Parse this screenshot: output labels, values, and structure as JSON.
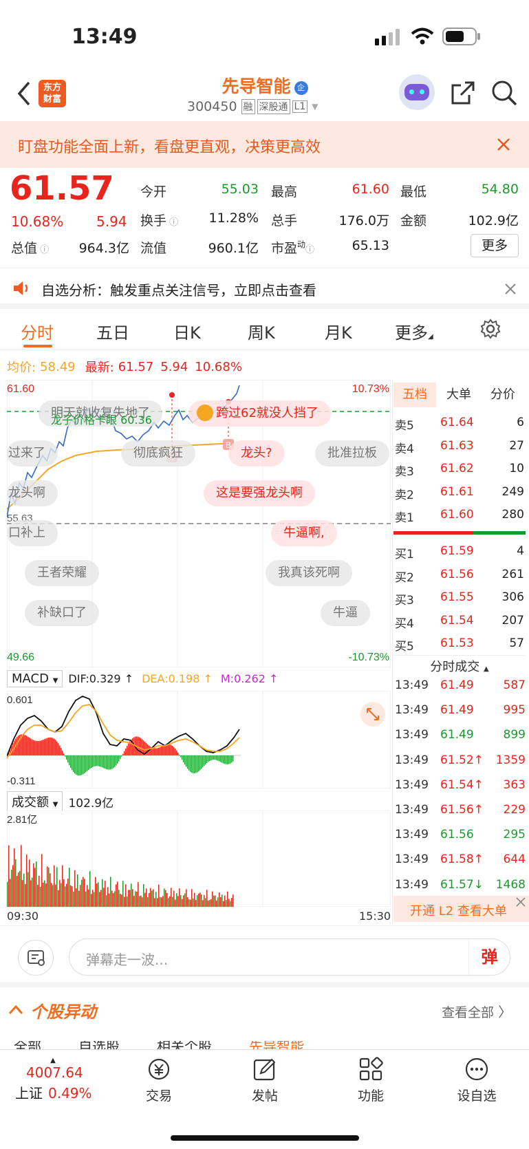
{
  "status": {
    "time": "13:49"
  },
  "header": {
    "logo_line1": "东方",
    "logo_line2": "财富",
    "stock_name": "先导智能",
    "badge": "企",
    "code": "300450",
    "tags": [
      "融",
      "深股通",
      "L1"
    ]
  },
  "banner": {
    "text": "盯盘功能全面上新，看盘更直观，决策更高效"
  },
  "quote": {
    "price": "61.57",
    "pct": "10.68%",
    "change": "5.94",
    "labels": {
      "open": "今开",
      "high": "最高",
      "low": "最低",
      "turnover": "换手",
      "volume": "总手",
      "amount": "金额",
      "mktcap": "总值",
      "float": "流值",
      "pe": "市盈",
      "pe_sup": "动"
    },
    "open": "55.03",
    "high": "61.60",
    "low": "54.80",
    "turnover": "11.28%",
    "volume": "176.0万",
    "amount": "102.9亿",
    "mktcap": "964.3亿",
    "float": "960.1亿",
    "pe": "65.13",
    "more": "更多"
  },
  "notice": {
    "text": "自选分析：触发重点关注信号，立即点击查看"
  },
  "tabs": [
    "分时",
    "五日",
    "日K",
    "周K",
    "月K",
    "更多"
  ],
  "chart_info": {
    "avg_label": "均价:",
    "avg_value": "58.49",
    "last_label": "最新:",
    "last_value": "61.57",
    "change": "5.94",
    "pct": "10.68%"
  },
  "axis": {
    "top_price": "61.60",
    "bottom_price": "49.66",
    "top_pct": "10.73%",
    "bottom_pct": "-10.73%",
    "mid_price": "55.63",
    "start_time": "09:30",
    "end_time": "15:30"
  },
  "marker": {
    "b1": "B",
    "b2": "B"
  },
  "macd": {
    "name": "MACD",
    "dif": "DIF:0.329 ↑",
    "dea": "DEA:0.198 ↑",
    "m": "M:0.262 ↑",
    "top": "0.601",
    "bottom": "-0.311"
  },
  "volume_panel": {
    "name": "成交额",
    "total": "102.9亿",
    "top": "2.81亿"
  },
  "danmu": [
    "明天就收复失地了",
    "龙子价格卡眼 60.36",
    "跨过62就没人挡了",
    "过来了",
    "彻底疯狂",
    "龙头?",
    "批准拉板",
    "龙头啊",
    "这是要强龙头啊",
    "口补上",
    "牛逼啊,",
    "王者荣耀",
    "我真该死啊",
    "补缺口了",
    "牛逼"
  ],
  "orderbook": {
    "tabs": [
      "五档",
      "大单",
      "分价"
    ],
    "asks": [
      {
        "label": "卖5",
        "price": "61.64",
        "qty": "6"
      },
      {
        "label": "卖4",
        "price": "61.63",
        "qty": "27"
      },
      {
        "label": "卖3",
        "price": "61.62",
        "qty": "10"
      },
      {
        "label": "卖2",
        "price": "61.61",
        "qty": "249"
      },
      {
        "label": "卖1",
        "price": "61.60",
        "qty": "280"
      }
    ],
    "bids": [
      {
        "label": "买1",
        "price": "61.59",
        "qty": "4"
      },
      {
        "label": "买2",
        "price": "61.56",
        "qty": "261"
      },
      {
        "label": "买3",
        "price": "61.55",
        "qty": "306"
      },
      {
        "label": "买4",
        "price": "61.54",
        "qty": "207"
      },
      {
        "label": "买5",
        "price": "61.53",
        "qty": "57"
      }
    ]
  },
  "trades": {
    "title": "分时成交",
    "rows": [
      {
        "time": "13:49",
        "price": "61.49",
        "vol": "587",
        "color": "red"
      },
      {
        "time": "13:49",
        "price": "61.49",
        "vol": "995",
        "color": "red"
      },
      {
        "time": "13:49",
        "price": "61.49",
        "vol": "899",
        "color": "green"
      },
      {
        "time": "13:49",
        "price": "61.52↑",
        "vol": "1359",
        "color": "red"
      },
      {
        "time": "13:49",
        "price": "61.54↑",
        "vol": "363",
        "color": "red"
      },
      {
        "time": "13:49",
        "price": "61.56↑",
        "vol": "229",
        "color": "red"
      },
      {
        "time": "13:49",
        "price": "61.56",
        "vol": "295",
        "color": "green"
      },
      {
        "time": "13:49",
        "price": "61.58↑",
        "vol": "644",
        "color": "red"
      },
      {
        "time": "13:49",
        "price": "61.57↓",
        "vol": "1468",
        "color": "green"
      }
    ],
    "l2": "开通 L2 查看大单"
  },
  "comment": {
    "placeholder": "弹幕走一波...",
    "btn": "弹"
  },
  "movement": {
    "title": "个股异动",
    "view_all": "查看全部",
    "subtabs": [
      "全部",
      "自选股",
      "相关个股",
      "先导智能"
    ]
  },
  "bottom_nav": {
    "index_value": "4007.64",
    "index_name": "上证",
    "index_pct": "0.49%",
    "items": [
      "交易",
      "发帖",
      "功能",
      "设自选"
    ]
  },
  "colors": {
    "red": "#e8251c",
    "green": "#1a9a2e",
    "orange": "#f26c22",
    "price_line": "#3a6fc4",
    "avg_line": "#f5a623"
  }
}
